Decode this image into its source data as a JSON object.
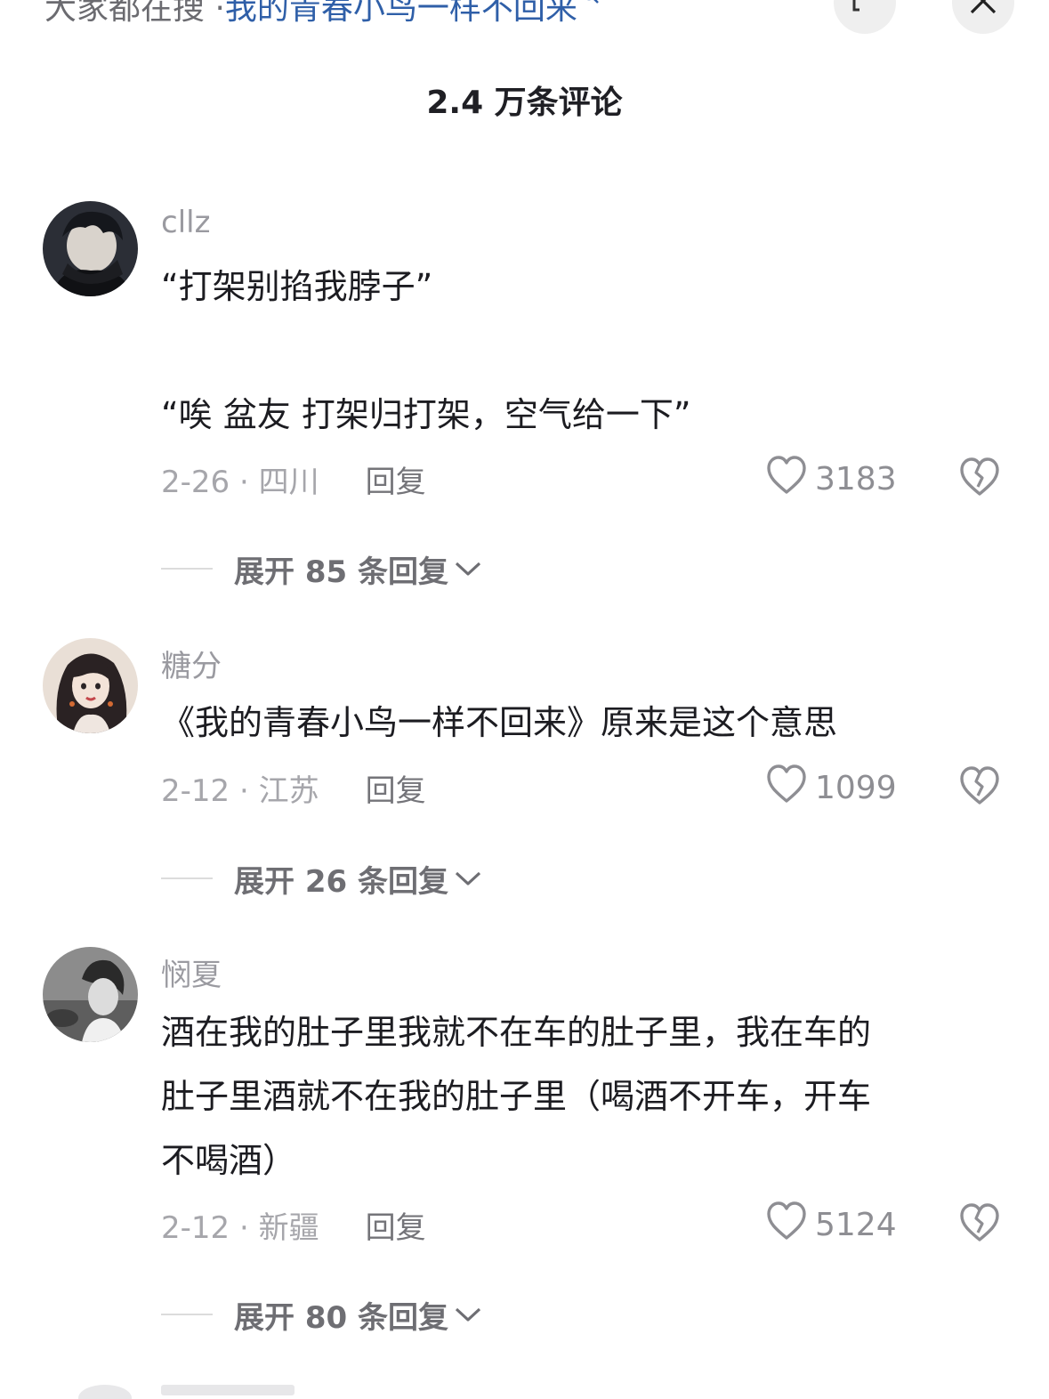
{
  "top_bar": {
    "prefix": "大家都在搜 · ",
    "query": "我的青春小鸟一样不回来",
    "expand_icon": "expand-icon",
    "close_icon": "close-icon"
  },
  "comment_count": "2.4 万条评论",
  "comments": [
    {
      "username": "cllz",
      "lines": [
        "“打架别掐我脖子”",
        "",
        "“唉 盆友 打架归打架，空气给一下”"
      ],
      "date_location": "2-26 · 四川",
      "reply_label": "回复",
      "likes": "3183",
      "expand_label": "展开 85 条回复"
    },
    {
      "username": "糖分",
      "lines": [
        "《我的青春小鸟一样不回来》原来是这个意思"
      ],
      "date_location": "2-12 · 江苏",
      "reply_label": "回复",
      "likes": "1099",
      "expand_label": "展开 26 条回复"
    },
    {
      "username": "悯夏",
      "lines": [
        "酒在我的肚子里我就不在车的肚子里，我在车的",
        "肚子里酒就不在我的肚子里（喝酒不开车，开车",
        "不喝酒）"
      ],
      "date_location": "2-12 · 新疆",
      "reply_label": "回复",
      "likes": "5124",
      "expand_label": "展开 80 条回复"
    }
  ],
  "icons": {
    "like": "heart-outline-icon",
    "dislike": "broken-heart-icon",
    "expand": "chevron-down-icon"
  },
  "colors": {
    "link_blue": "#2f5fa8",
    "secondary_text": "#a6a6ab",
    "primary_text": "#1c1c21"
  }
}
